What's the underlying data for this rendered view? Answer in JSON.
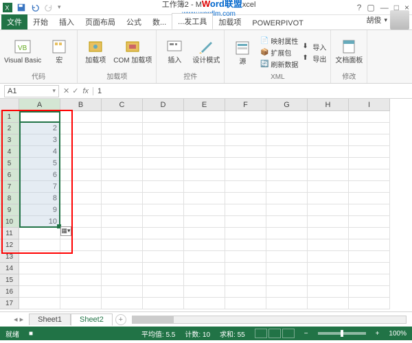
{
  "title": {
    "doc": "工作簿2 - M",
    "app": "xcel",
    "wm_left": "W",
    "wm_mid": "ord联盟",
    "wm_url": "www.wordlm.com"
  },
  "window_buttons": {
    "help": "?",
    "ribbon": "▢",
    "min": "—",
    "max": "□",
    "close": "×"
  },
  "tabs": {
    "file": "文件",
    "home": "开始",
    "insert": "插入",
    "layout": "页面布局",
    "formulas": "公式",
    "data": "数...",
    "dev": "...发工具",
    "addins": "加载项",
    "powerpivot": "POWERPIVOT",
    "user": "胡俊"
  },
  "ribbon": {
    "code": {
      "vb": "Visual Basic",
      "macro": "宏",
      "label": "代码"
    },
    "addins_grp": {
      "addin": "加载项",
      "com": "COM 加载项",
      "label": "加载项"
    },
    "controls": {
      "insert": "插入",
      "design": "设计模式",
      "label": "控件"
    },
    "xml": {
      "source": "源",
      "props": "映射属性",
      "expand": "扩展包",
      "refresh": "刷新数据",
      "import": "导入",
      "export": "导出",
      "label": "XML"
    },
    "modify": {
      "panel": "文档面板",
      "label": "修改"
    }
  },
  "namebox": "A1",
  "formula": "1",
  "columns": [
    "A",
    "B",
    "C",
    "D",
    "E",
    "F",
    "G",
    "H",
    "I"
  ],
  "rows": [
    "1",
    "2",
    "3",
    "4",
    "5",
    "6",
    "7",
    "8",
    "9",
    "10",
    "11",
    "12",
    "13",
    "14",
    "15",
    "16",
    "17"
  ],
  "cell_values": [
    "1",
    "2",
    "3",
    "4",
    "5",
    "6",
    "7",
    "8",
    "9",
    "10"
  ],
  "sheets": {
    "s1": "Sheet1",
    "s2": "Sheet2"
  },
  "status": {
    "ready": "就绪",
    "calc": "■",
    "avg_lbl": "平均值:",
    "avg": "5.5",
    "count_lbl": "计数:",
    "count": "10",
    "sum_lbl": "求和:",
    "sum": "55",
    "zoom": "100%"
  }
}
